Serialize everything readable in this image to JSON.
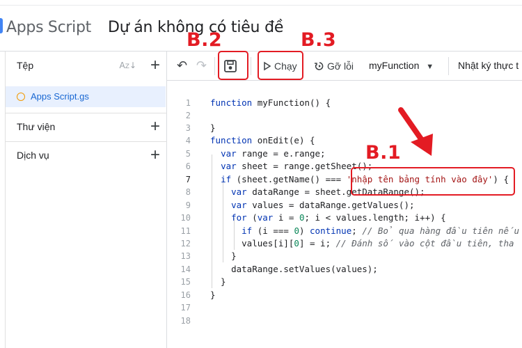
{
  "header": {
    "app_name": "Apps Script",
    "project_title": "Dự án không có tiêu đề"
  },
  "sidebar": {
    "files_label": "Tệp",
    "sort_icon": "sort-az-icon",
    "active_file": "Apps Script.gs",
    "libraries_label": "Thư viện",
    "services_label": "Dịch vụ"
  },
  "toolbar": {
    "run_label": "Chạy",
    "debug_label": "Gỡ lỗi",
    "function_select": "myFunction",
    "log_label": "Nhật ký thực t"
  },
  "editor": {
    "line_numbers": [
      "1",
      "2",
      "3",
      "4",
      "5",
      "6",
      "7",
      "8",
      "9",
      "10",
      "11",
      "12",
      "13",
      "14",
      "15",
      "16",
      "17",
      "18"
    ],
    "active_line": 7
  },
  "annotations": {
    "b1": "B.1",
    "b2": "B.2",
    "b3": "B.3"
  },
  "colors": {
    "annotation_red": "#e31b23",
    "keyword_blue": "#0033b3",
    "string_red": "#a31515",
    "active_file_bg": "#e8f0fe"
  }
}
